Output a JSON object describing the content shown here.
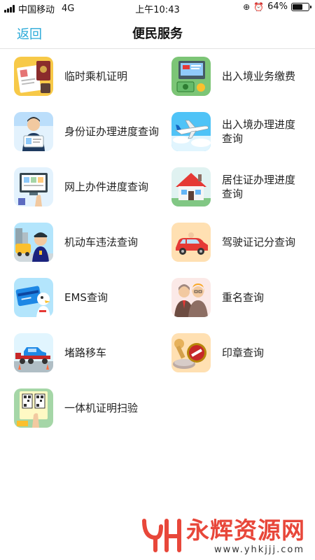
{
  "status_bar": {
    "carrier": "中国移动",
    "network": "4G",
    "time": "上午10:43",
    "battery": "64%",
    "battery_level": 0.64
  },
  "nav": {
    "back_label": "返回",
    "title": "便民服务"
  },
  "services": [
    {
      "label": "临时乘机证明",
      "icon": "boarding-certificate-icon"
    },
    {
      "label": "出入境业务缴费",
      "icon": "exit-entry-payment-icon"
    },
    {
      "label": "身份证办理进度查询",
      "icon": "id-card-progress-icon"
    },
    {
      "label": "出入境办理进度查询",
      "icon": "airplane-icon"
    },
    {
      "label": "网上办件进度查询",
      "icon": "online-case-icon"
    },
    {
      "label": "居住证办理进度查询",
      "icon": "house-icon"
    },
    {
      "label": "机动车违法查询",
      "icon": "traffic-police-icon"
    },
    {
      "label": "驾驶证记分查询",
      "icon": "car-icon"
    },
    {
      "label": "EMS查询",
      "icon": "ems-card-icon"
    },
    {
      "label": "重名查询",
      "icon": "people-icon"
    },
    {
      "label": "堵路移车",
      "icon": "tow-truck-icon"
    },
    {
      "label": "印章查询",
      "icon": "seal-stamp-icon"
    },
    {
      "label": "一体机证明扫验",
      "icon": "qr-scan-icon"
    }
  ],
  "watermark": {
    "title": "永辉资源网",
    "url": "www.yhkjjj.com",
    "color": "#e8473a"
  },
  "colors": {
    "accent": "#29a9d8"
  }
}
